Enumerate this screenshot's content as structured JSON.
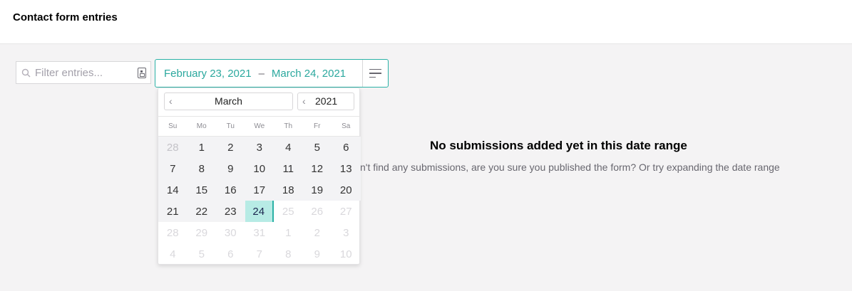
{
  "header": {
    "title": "Contact form entries"
  },
  "filter": {
    "placeholder": "Filter entries..."
  },
  "range": {
    "start": "February 23, 2021",
    "separator": "–",
    "end": "March 24, 2021"
  },
  "calendar": {
    "month": "March",
    "year": "2021",
    "weekdays": [
      "Su",
      "Mo",
      "Tu",
      "We",
      "Th",
      "Fr",
      "Sa"
    ],
    "days": [
      {
        "d": "28",
        "s": "inrange muted"
      },
      {
        "d": "1",
        "s": "inrange"
      },
      {
        "d": "2",
        "s": "inrange"
      },
      {
        "d": "3",
        "s": "inrange"
      },
      {
        "d": "4",
        "s": "inrange"
      },
      {
        "d": "5",
        "s": "inrange"
      },
      {
        "d": "6",
        "s": "inrange"
      },
      {
        "d": "7",
        "s": "inrange"
      },
      {
        "d": "8",
        "s": "inrange"
      },
      {
        "d": "9",
        "s": "inrange"
      },
      {
        "d": "10",
        "s": "inrange"
      },
      {
        "d": "11",
        "s": "inrange"
      },
      {
        "d": "12",
        "s": "inrange"
      },
      {
        "d": "13",
        "s": "inrange"
      },
      {
        "d": "14",
        "s": "inrange"
      },
      {
        "d": "15",
        "s": "inrange"
      },
      {
        "d": "16",
        "s": "inrange"
      },
      {
        "d": "17",
        "s": "inrange"
      },
      {
        "d": "18",
        "s": "inrange"
      },
      {
        "d": "19",
        "s": "inrange"
      },
      {
        "d": "20",
        "s": "inrange"
      },
      {
        "d": "21",
        "s": "inrange"
      },
      {
        "d": "22",
        "s": "inrange"
      },
      {
        "d": "23",
        "s": "inrange"
      },
      {
        "d": "24",
        "s": "selected"
      },
      {
        "d": "25",
        "s": "faded"
      },
      {
        "d": "26",
        "s": "faded"
      },
      {
        "d": "27",
        "s": "faded"
      },
      {
        "d": "28",
        "s": "faded"
      },
      {
        "d": "29",
        "s": "faded"
      },
      {
        "d": "30",
        "s": "faded"
      },
      {
        "d": "31",
        "s": "faded"
      },
      {
        "d": "1",
        "s": "faded"
      },
      {
        "d": "2",
        "s": "faded"
      },
      {
        "d": "3",
        "s": "faded"
      },
      {
        "d": "4",
        "s": "faded"
      },
      {
        "d": "5",
        "s": "faded"
      },
      {
        "d": "6",
        "s": "faded"
      },
      {
        "d": "7",
        "s": "faded"
      },
      {
        "d": "8",
        "s": "faded"
      },
      {
        "d": "9",
        "s": "faded"
      },
      {
        "d": "10",
        "s": "faded"
      }
    ]
  },
  "empty": {
    "title": "No submissions added yet in this date range",
    "subtitle": "n't find any submissions, are you sure you published the form? Or try expanding the date range"
  },
  "colors": {
    "accent": "#2bb1a6",
    "selected_bg": "#b7ebe5"
  }
}
